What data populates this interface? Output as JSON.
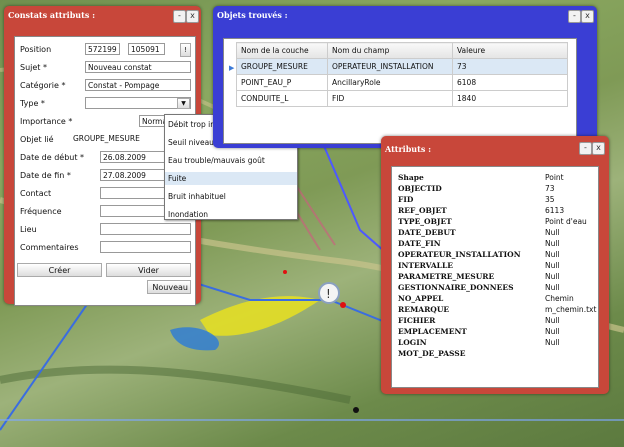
{
  "constats": {
    "title": "Constats attributs :",
    "controls": [
      "-",
      "x"
    ],
    "fields": {
      "position_label": "Position",
      "position_x": "572199",
      "position_y": "105091",
      "sujet_label": "Sujet *",
      "sujet_value": "Nouveau constat",
      "categorie_label": "Catégorie *",
      "categorie_value": "Constat - Pompage",
      "type_label": "Type *",
      "importance_label": "Importance *",
      "importance_value": "Norma",
      "objet_lie_label": "Objet lié",
      "objet_lie_value": "GROUPE_MESURE",
      "date_debut_label": "Date de début *",
      "date_debut_value": "26.08.2009",
      "date_fin_label": "Date de fin *",
      "date_fin_value": "27.08.2009",
      "contact_label": "Contact",
      "frequence_label": "Fréquence",
      "lieu_label": "Lieu",
      "commentaires_label": "Commentaires"
    },
    "buttons": {
      "creer": "Créer",
      "vider": "Vider",
      "nouveau": "Nouveau"
    },
    "type_options": [
      "Débit trop important/insuffisant",
      "Seuil niveau bas/niveau incendit",
      "Eau trouble/mauvais goût",
      "Fuite",
      "Bruit inhabituel",
      "Inondation"
    ],
    "type_highlighted": "Fuite"
  },
  "objets": {
    "title": "Objets trouvés :",
    "controls": [
      "-",
      "x"
    ],
    "columns": [
      "Nom de la couche",
      "Nom du champ",
      "Valeure"
    ],
    "rows": [
      [
        "GROUPE_MESURE",
        "OPERATEUR_INSTALLATION",
        "73"
      ],
      [
        "POINT_EAU_P",
        "AncillaryRole",
        "6108"
      ],
      [
        "CONDUITE_L",
        "FID",
        "1840"
      ]
    ]
  },
  "attributs": {
    "title": "Attributs :",
    "controls": [
      "-",
      "x"
    ],
    "rows": [
      [
        "Shape",
        "Point"
      ],
      [
        "OBJECTID",
        "73"
      ],
      [
        "FID",
        "35"
      ],
      [
        "REF_OBJET",
        "6113"
      ],
      [
        "TYPE_OBJET",
        "Point d'eau"
      ],
      [
        "DATE_DEBUT",
        "Null"
      ],
      [
        "DATE_FIN",
        "Null"
      ],
      [
        "OPERATEUR_INSTALLATION",
        "Null"
      ],
      [
        "INTERVALLE",
        "Null"
      ],
      [
        "PARAMETRE_MESURE",
        "Null"
      ],
      [
        "GESTIONNAIRE_DONNEES",
        "Null"
      ],
      [
        "NO_APPEL",
        "Chemin"
      ],
      [
        "REMARQUE",
        "m_chemin.txt"
      ],
      [
        "FICHIER",
        "Null"
      ],
      [
        "EMPLACEMENT",
        "Null"
      ],
      [
        "LOGIN",
        "Null"
      ],
      [
        "MOT_DE_PASSE",
        ""
      ]
    ]
  },
  "colors": {
    "red_panel": "#c8473a",
    "blue_panel": "#3a3ed4",
    "highlight": "#dbe8f5"
  }
}
